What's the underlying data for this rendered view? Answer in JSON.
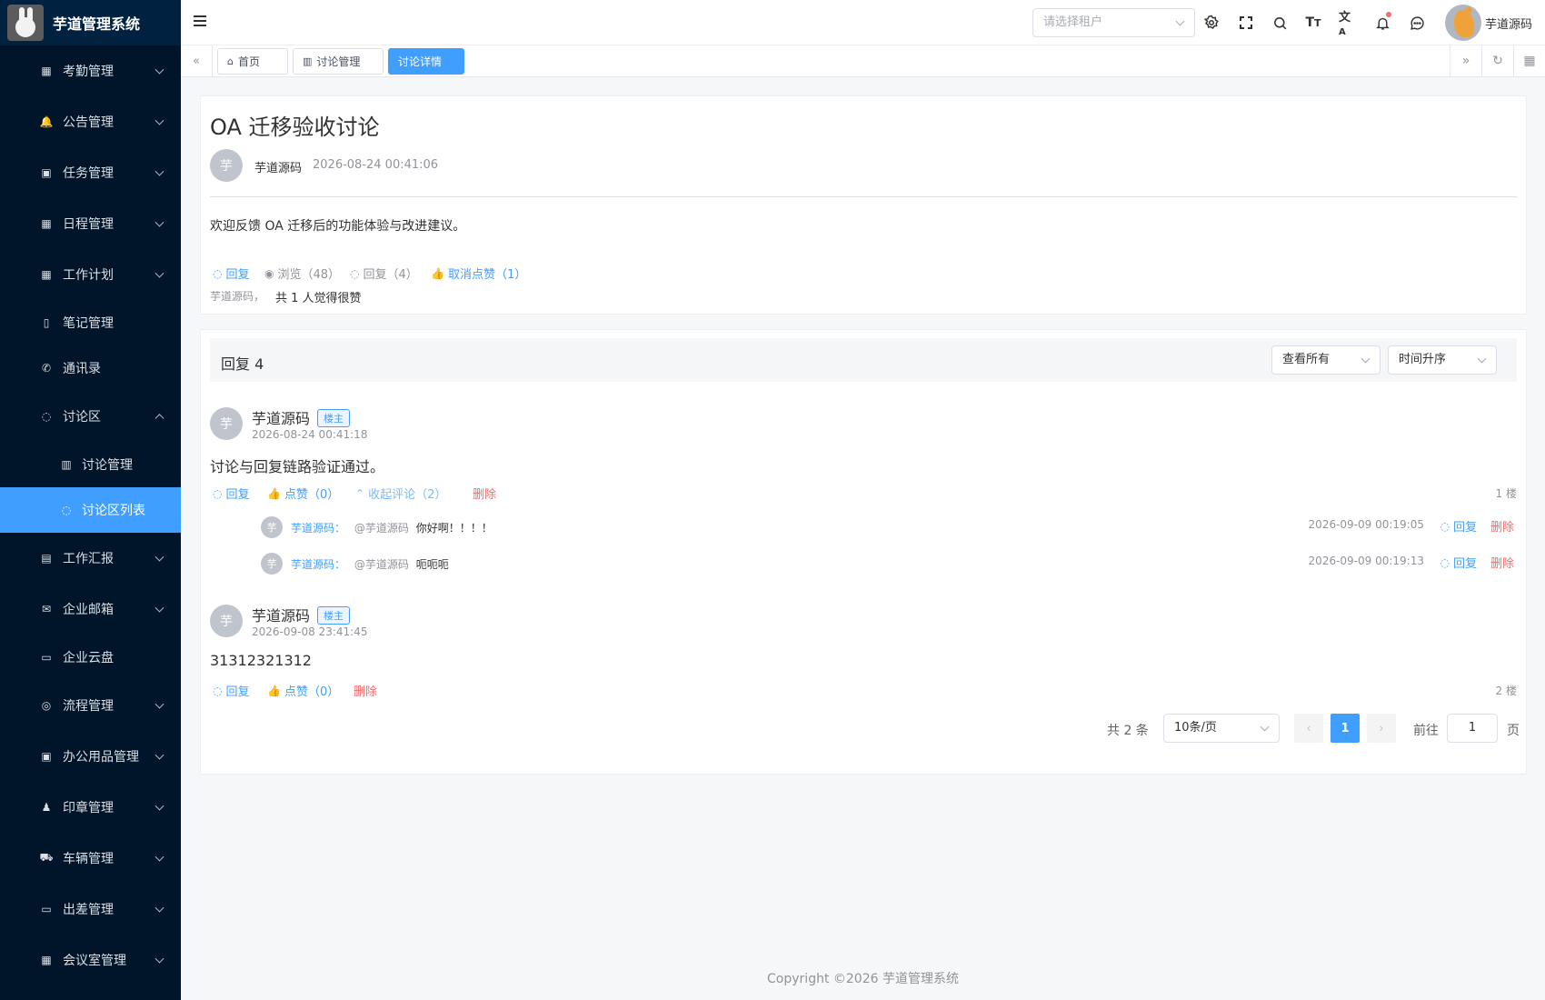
{
  "app": {
    "title": "芋道管理系统"
  },
  "sidebar": {
    "items": [
      {
        "label": "考勤管理",
        "icon": "calendar-icon",
        "arrow": "down"
      },
      {
        "label": "公告管理",
        "icon": "bell-icon",
        "arrow": "down"
      },
      {
        "label": "任务管理",
        "icon": "clipboard-icon",
        "arrow": "down"
      },
      {
        "label": "日程管理",
        "icon": "calendar-icon",
        "arrow": "down"
      },
      {
        "label": "工作计划",
        "icon": "calendar-icon",
        "arrow": "down"
      },
      {
        "label": "笔记管理",
        "icon": "notebook-icon",
        "arrow": ""
      },
      {
        "label": "通讯录",
        "icon": "phone-icon",
        "arrow": ""
      },
      {
        "label": "讨论区",
        "icon": "chat-icon",
        "arrow": "up"
      },
      {
        "label": "讨论管理",
        "icon": "books-icon",
        "arrow": "",
        "sub": true
      },
      {
        "label": "讨论区列表",
        "icon": "chat-icon",
        "arrow": "",
        "sub": true,
        "active": true
      },
      {
        "label": "工作汇报",
        "icon": "report-icon",
        "arrow": "down"
      },
      {
        "label": "企业邮箱",
        "icon": "mail-icon",
        "arrow": "down"
      },
      {
        "label": "企业云盘",
        "icon": "folder-icon",
        "arrow": ""
      },
      {
        "label": "流程管理",
        "icon": "flow-icon",
        "arrow": "down"
      },
      {
        "label": "办公用品管理",
        "icon": "box-icon",
        "arrow": "down"
      },
      {
        "label": "印章管理",
        "icon": "stamp-icon",
        "arrow": "down"
      },
      {
        "label": "车辆管理",
        "icon": "truck-icon",
        "arrow": "down"
      },
      {
        "label": "出差管理",
        "icon": "briefcase-icon",
        "arrow": "down"
      },
      {
        "label": "会议室管理",
        "icon": "building-icon",
        "arrow": "down"
      }
    ]
  },
  "header": {
    "tenant_placeholder": "请选择租户",
    "user_name": "芋道源码"
  },
  "tags": {
    "home": "首页",
    "discussion_manage": "讨论管理",
    "discussion_detail": "讨论详情"
  },
  "post": {
    "title": "OA 迁移验收讨论",
    "avatar_char": "芋",
    "author": "芋道源码",
    "time": "2026-08-24 00:41:06",
    "content": "欢迎反馈 OA 迁移后的功能体验与改进建议。",
    "reply_label": "回复",
    "views_label": "浏览（48）",
    "replies_label": "回复（4）",
    "unlike_label": "取消点赞（1）",
    "likers": "芋道源码，",
    "likes_summary": "共 1 人觉得很赞"
  },
  "replies": {
    "header": "回复 4",
    "filter_value": "查看所有",
    "sort_value": "时间升序",
    "owner_badge": "楼主",
    "reply_label": "回复",
    "delete_label": "删除",
    "list": [
      {
        "avatar_char": "芋",
        "author": "芋道源码",
        "time": "2026-08-24 00:41:18",
        "content": "讨论与回复链路验证通过。",
        "like_label": "点赞（0）",
        "collapse_label": "收起评论（2）",
        "floor": "1 楼",
        "comments": [
          {
            "avatar_char": "芋",
            "author": "芋道源码：",
            "mention": "@芋道源码",
            "text": "你好啊！！！！",
            "time": "2026-09-09 00:19:05"
          },
          {
            "avatar_char": "芋",
            "author": "芋道源码：",
            "mention": "@芋道源码",
            "text": "呃呃呃",
            "time": "2026-09-09 00:19:13"
          }
        ]
      },
      {
        "avatar_char": "芋",
        "author": "芋道源码",
        "time": "2026-09-08 23:41:45",
        "content": "31312321312",
        "like_label": "点赞（0）",
        "floor": "2 楼"
      }
    ]
  },
  "pagination": {
    "total": "共 2 条",
    "page_size": "10条/页",
    "current_page": "1",
    "goto_label": "前往",
    "goto_value": "1",
    "page_unit": "页"
  },
  "footer": {
    "copyright": "Copyright ©2026 芋道管理系统"
  },
  "colors": {
    "primary": "#409eff",
    "sidebar_bg": "#001529",
    "danger": "#f56c6c"
  }
}
